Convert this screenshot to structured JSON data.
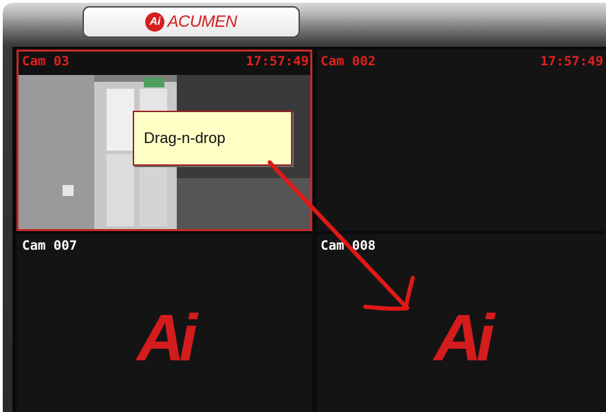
{
  "branding": {
    "logo_mark": "Ai",
    "logo_text": "ACUMEN"
  },
  "cameras": [
    {
      "label": "Cam 03",
      "time": "17:57:49",
      "state": "selected"
    },
    {
      "label": "Cam 002",
      "time": "17:57:49",
      "state": "no-video"
    },
    {
      "label": "Cam 007",
      "time": "",
      "state": "logo"
    },
    {
      "label": "Cam 008",
      "time": "",
      "state": "logo"
    }
  ],
  "placeholder_logo": "Ai",
  "tooltip": {
    "text": "Drag-n-drop"
  },
  "colors": {
    "accent": "#e02020",
    "selected_border": "#c42a2a",
    "tooltip_bg": "#ffffc6"
  }
}
